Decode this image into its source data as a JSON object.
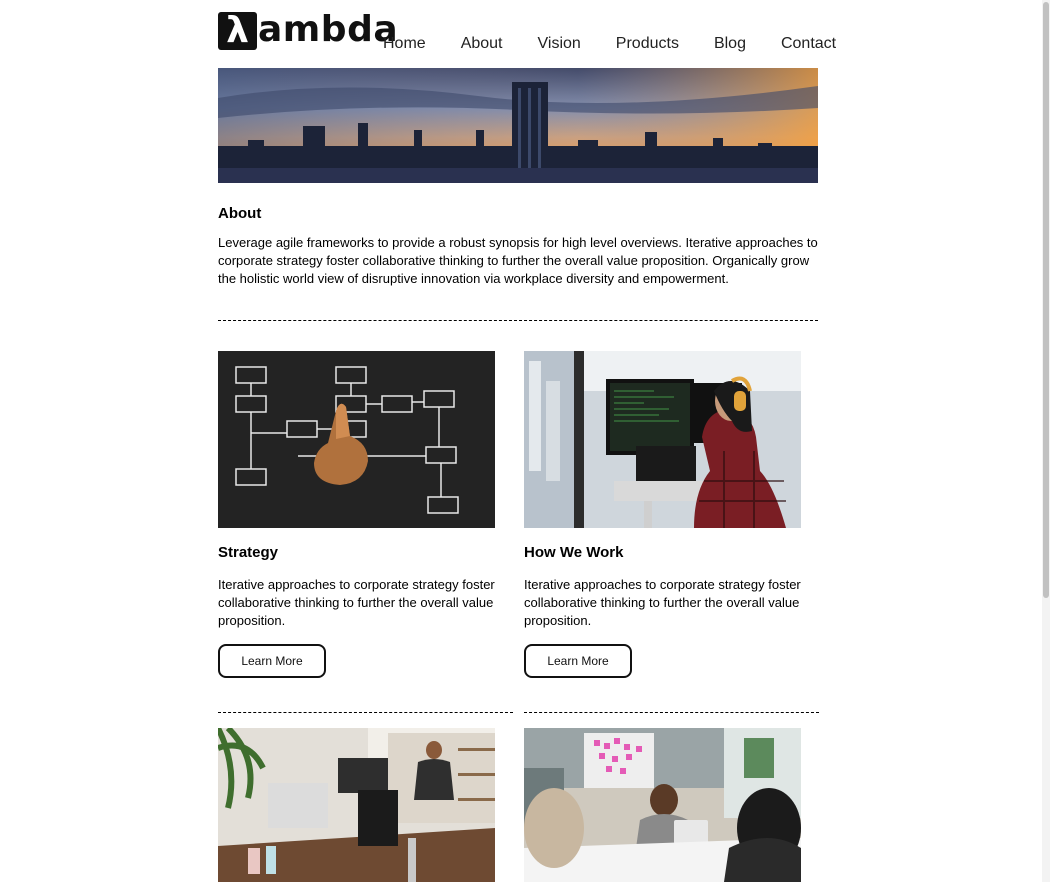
{
  "brand": {
    "logo_glyph": "λ",
    "logo_text": "ambda"
  },
  "nav": {
    "items": [
      "Home",
      "About",
      "Vision",
      "Products",
      "Blog",
      "Contact"
    ]
  },
  "about": {
    "heading": "About",
    "body": "Leverage agile frameworks to provide a robust synopsis for high level overviews. Iterative approaches to corporate strategy foster collaborative thinking to further the overall value proposition. Organically grow the holistic world view of disruptive innovation via workplace diversity and empowerment."
  },
  "cards": [
    {
      "heading": "Strategy",
      "body": "Iterative approaches to corporate strategy foster collaborative thinking to further the overall value proposition.",
      "button": "Learn More"
    },
    {
      "heading": "How We Work",
      "body": "Iterative approaches to corporate strategy foster collaborative thinking to further the overall value proposition.",
      "button": "Learn More"
    }
  ],
  "icons": {
    "hero": "city-skyline-image",
    "card1": "flowchart-image",
    "card2": "developer-workstation-image",
    "row2_left": "office-desk-image",
    "row2_right": "meeting-image"
  }
}
